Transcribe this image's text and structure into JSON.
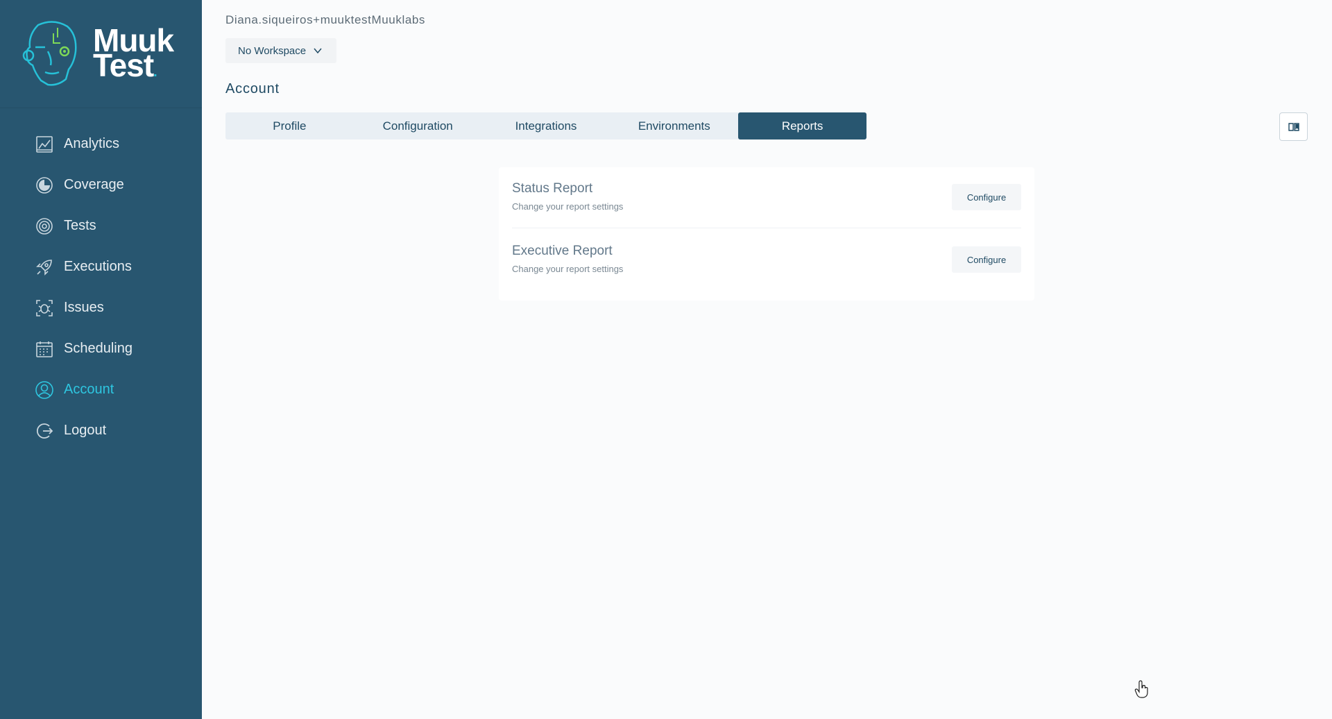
{
  "brand": {
    "line1": "Muuk",
    "line2": "Test",
    "accent": "#2ec6e0",
    "sidebar_bg": "#285670"
  },
  "sidebar": {
    "items": [
      {
        "label": "Analytics",
        "icon": "analytics-icon",
        "active": false
      },
      {
        "label": "Coverage",
        "icon": "coverage-icon",
        "active": false
      },
      {
        "label": "Tests",
        "icon": "tests-icon",
        "active": false
      },
      {
        "label": "Executions",
        "icon": "rocket-icon",
        "active": false
      },
      {
        "label": "Issues",
        "icon": "bug-icon",
        "active": false
      },
      {
        "label": "Scheduling",
        "icon": "calendar-icon",
        "active": false
      },
      {
        "label": "Account",
        "icon": "user-icon",
        "active": true
      },
      {
        "label": "Logout",
        "icon": "logout-icon",
        "active": false
      }
    ]
  },
  "header": {
    "user_email": "Diana.siqueiros+muuktestMuuklabs",
    "workspace_label": "No Workspace",
    "page_title": "Account"
  },
  "tabs": [
    {
      "label": "Profile",
      "active": false
    },
    {
      "label": "Configuration",
      "active": false
    },
    {
      "label": "Integrations",
      "active": false
    },
    {
      "label": "Environments",
      "active": false
    },
    {
      "label": "Reports",
      "active": true
    }
  ],
  "reports": [
    {
      "title": "Status Report",
      "subtitle": "Change your report settings",
      "button": "Configure"
    },
    {
      "title": "Executive Report",
      "subtitle": "Change your report settings",
      "button": "Configure"
    }
  ]
}
